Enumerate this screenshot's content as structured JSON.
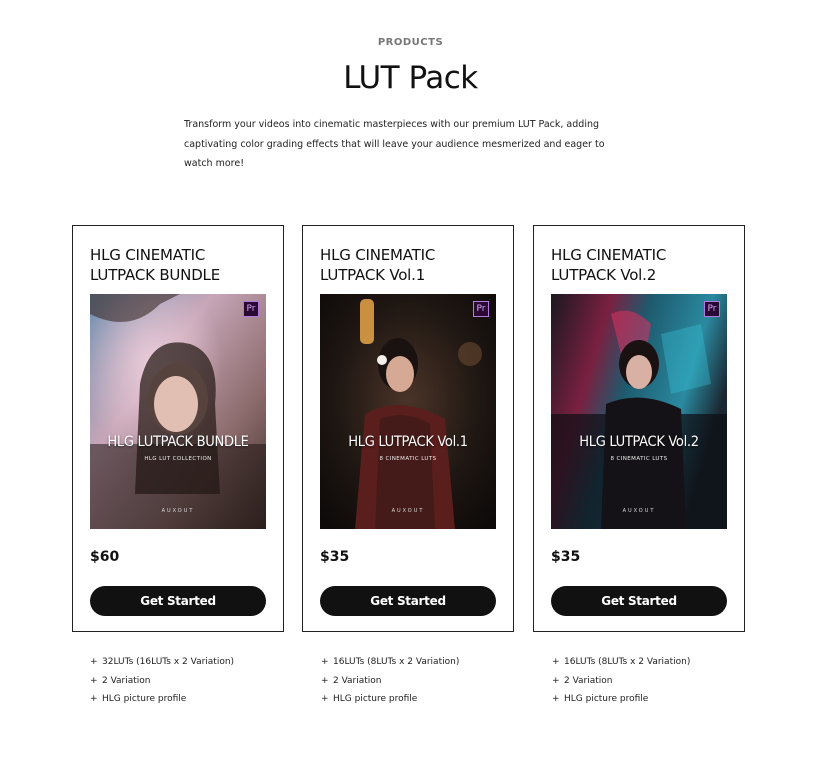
{
  "header": {
    "eyebrow": "PRODUCTS",
    "title": "LUT Pack",
    "description": "Transform your videos into cinematic masterpieces with our premium LUT Pack, adding captivating color grading effects that will leave your audience mesmerized and eager to watch more!"
  },
  "products": [
    {
      "title_line1": "HLG CINEMATIC",
      "title_line2": "LUTPACK BUNDLE",
      "badge": "Pr",
      "image_title": "HLG LUTPACK BUNDLE",
      "image_subtitle": "HLG LUT COLLECTION",
      "image_brand": "AUXOUT",
      "price": "$60",
      "cta": "Get Started",
      "features": [
        "32LUTs (16LUTs x 2 Variation)",
        "2 Variation",
        "HLG picture profile"
      ]
    },
    {
      "title_line1": "HLG CINEMATIC",
      "title_line2": "LUTPACK Vol.1",
      "badge": "Pr",
      "image_title": "HLG LUTPACK Vol.1",
      "image_subtitle": "8 CINEMATIC LUTS",
      "image_brand": "AUXOUT",
      "price": "$35",
      "cta": "Get Started",
      "features": [
        "16LUTs (8LUTs x 2 Variation)",
        "2 Variation",
        "HLG picture profile"
      ]
    },
    {
      "title_line1": "HLG CINEMATIC",
      "title_line2": "LUTPACK Vol.2",
      "badge": "Pr",
      "image_title": "HLG LUTPACK Vol.2",
      "image_subtitle": "8 CINEMATIC LUTS",
      "image_brand": "AUXOUT",
      "price": "$35",
      "cta": "Get Started",
      "features": [
        "16LUTs (8LUTs x 2 Variation)",
        "2 Variation",
        "HLG picture profile"
      ]
    }
  ],
  "icons": {
    "feature_bullet": "+",
    "premiere_badge": "premiere-pro-icon"
  }
}
